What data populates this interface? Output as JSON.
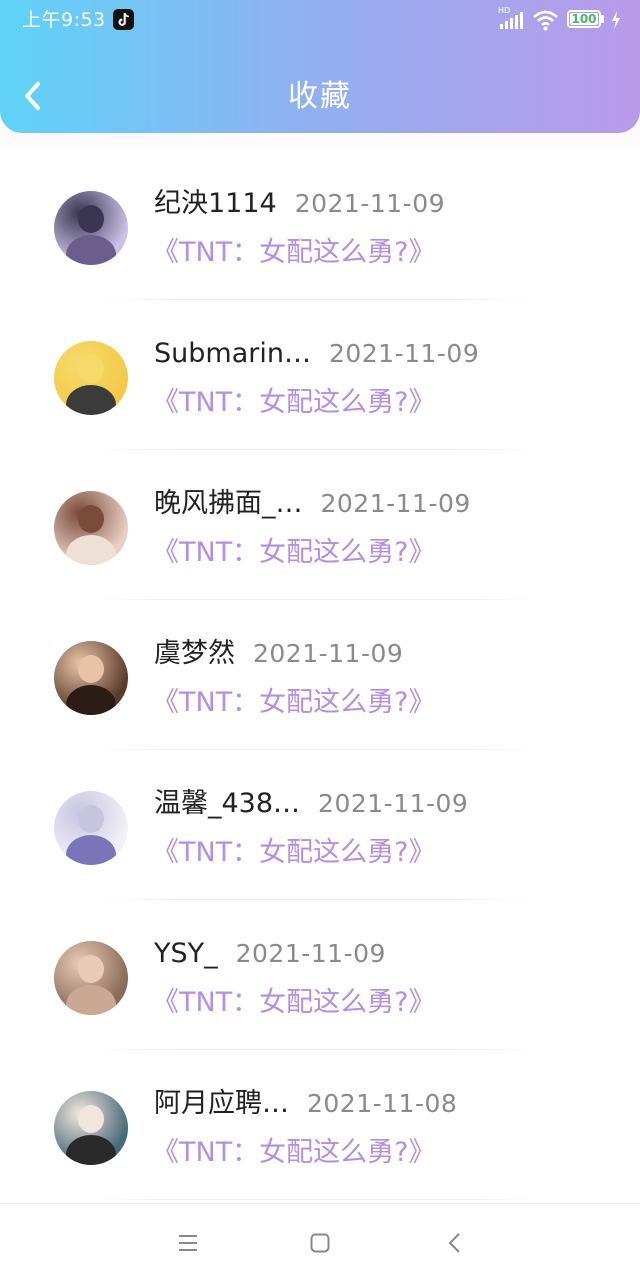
{
  "status_bar": {
    "time": "上午9:53",
    "network_label": "HD",
    "battery_level": "100",
    "battery_fraction": 1.0
  },
  "header": {
    "title": "收藏",
    "back_icon": "chevron-left-icon"
  },
  "items": [
    {
      "name": "纪泱1114",
      "date": "2021-11-09",
      "book": "《TNT：女配这么勇?》",
      "avatar_colors": [
        "#c9c2e6",
        "#3a3552",
        "#6b5e8c"
      ]
    },
    {
      "name": "Submarin…",
      "date": "2021-11-09",
      "book": "《TNT：女配这么勇?》",
      "avatar_colors": [
        "#f3c94a",
        "#f7d96a",
        "#3b3b3b"
      ]
    },
    {
      "name": "晚风拂面_…",
      "date": "2021-11-09",
      "book": "《TNT：女配这么勇?》",
      "avatar_colors": [
        "#e9cfc3",
        "#7a4a3b",
        "#efe0d6"
      ]
    },
    {
      "name": "虞梦然",
      "date": "2021-11-09",
      "book": "《TNT：女配这么勇?》",
      "avatar_colors": [
        "#5a3a2a",
        "#e8c3a8",
        "#2b1c16"
      ]
    },
    {
      "name": "温馨_438…",
      "date": "2021-11-09",
      "book": "《TNT：女配这么勇?》",
      "avatar_colors": [
        "#f2f0f7",
        "#c7c4e0",
        "#7c74b8"
      ]
    },
    {
      "name": "YSY_",
      "date": "2021-11-09",
      "book": "《TNT：女配这么勇?》",
      "avatar_colors": [
        "#8a6a58",
        "#e7cbb7",
        "#c9a993"
      ]
    },
    {
      "name": "阿月应聘…",
      "date": "2021-11-08",
      "book": "《TNT：女配这么勇?》",
      "avatar_colors": [
        "#4a6a7a",
        "#f2e6dc",
        "#2a2a2a"
      ]
    }
  ],
  "nav": {
    "menu_icon": "menu-icon",
    "home_icon": "home-square-icon",
    "back_icon": "back-triangle-icon"
  },
  "colors": {
    "header_gradient_start": "#5fd3f7",
    "header_gradient_end": "#b99ae9",
    "book_title": "#b48ee4",
    "date": "#8a8a8a"
  }
}
